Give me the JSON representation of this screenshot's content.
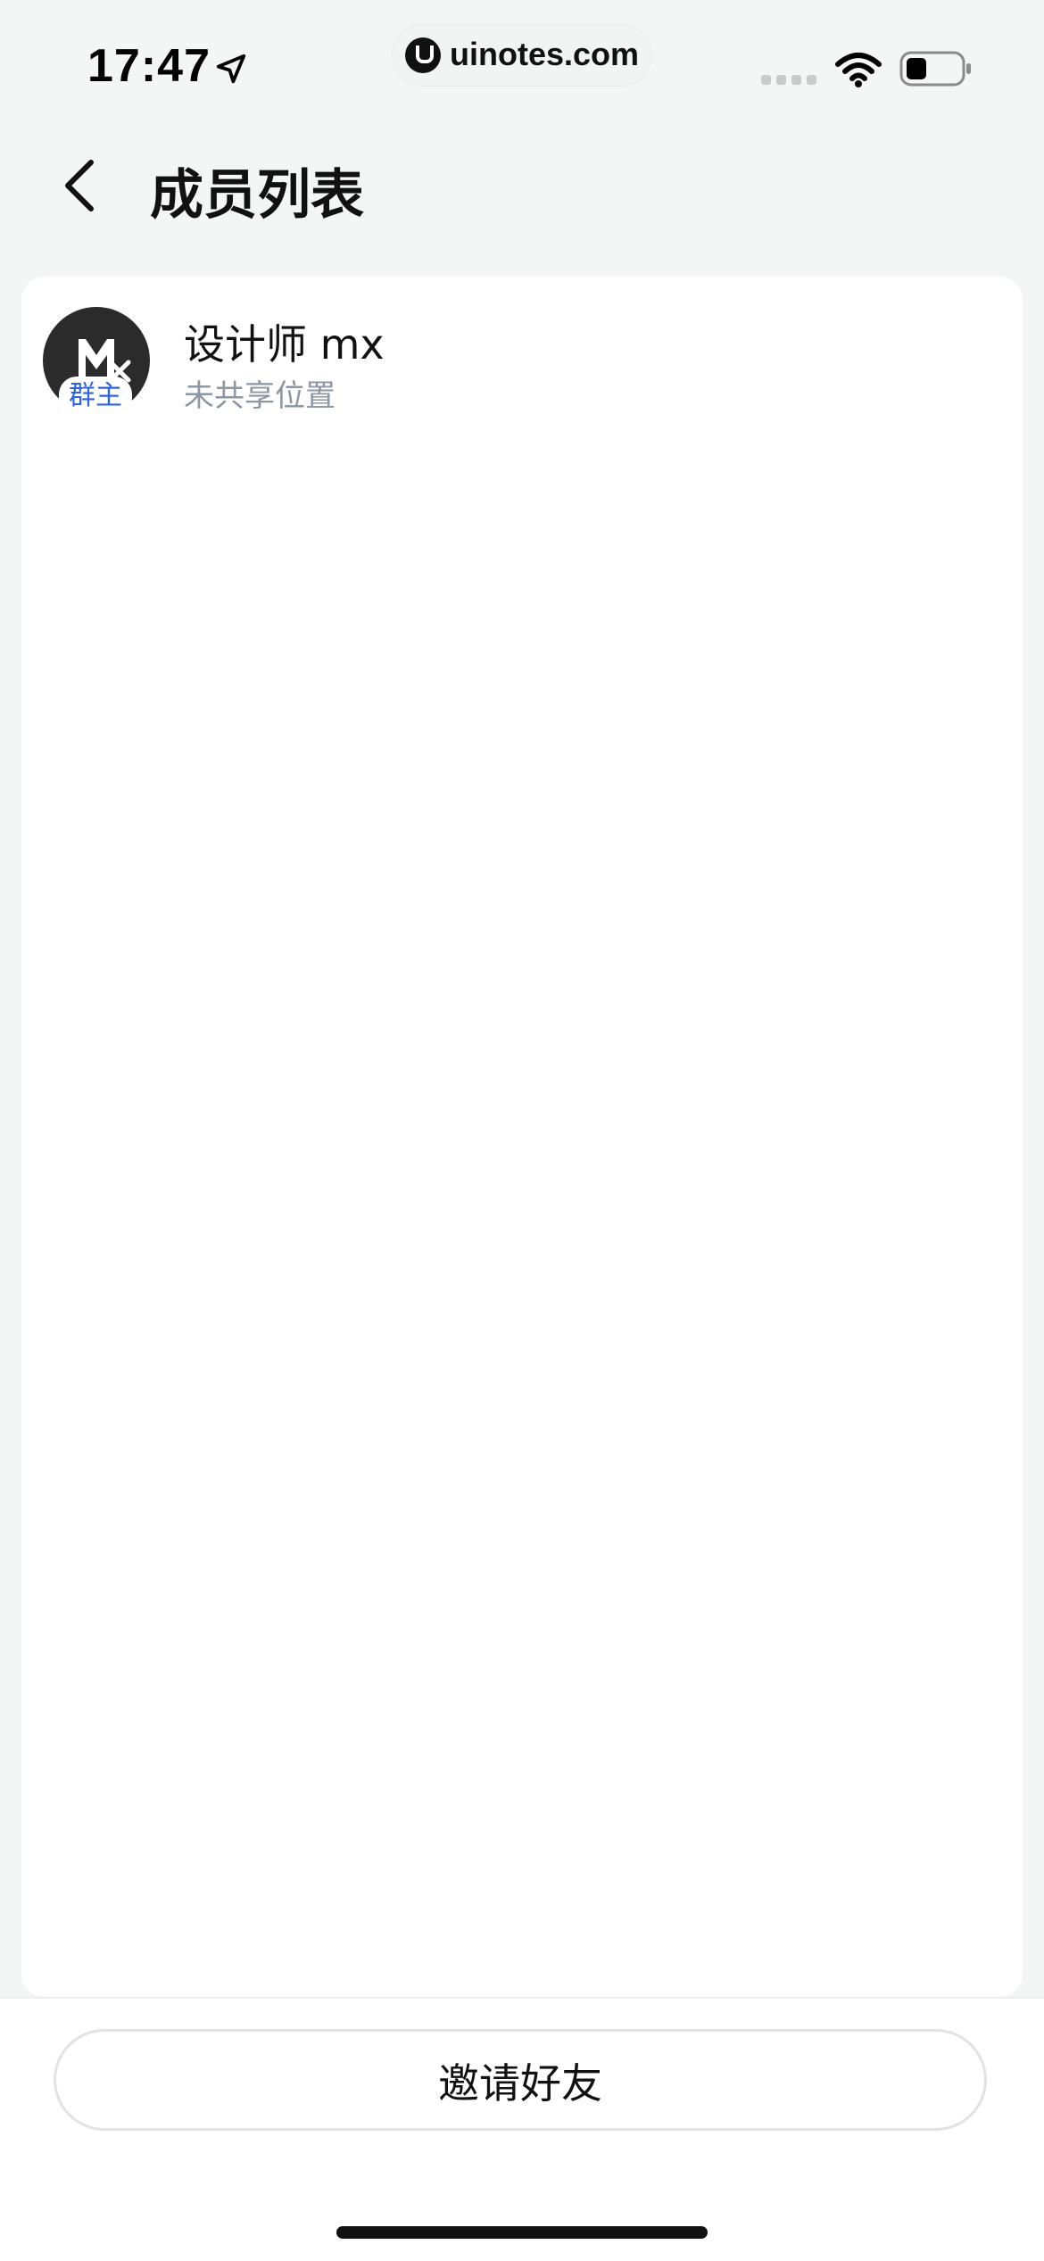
{
  "status_bar": {
    "time": "17:47",
    "url": "uinotes.com",
    "icons": [
      "location-arrow-icon",
      "uinotes-logo-icon",
      "signal-icon",
      "wifi-icon",
      "battery-icon"
    ]
  },
  "header": {
    "title": "成员列表",
    "back_icon": "chevron-left-icon"
  },
  "members": [
    {
      "name": "设计师 mx",
      "status": "未共享位置",
      "badge": "群主",
      "avatar_icon": "mx-logo-avatar"
    }
  ],
  "footer": {
    "invite_label": "邀请好友"
  },
  "colors": {
    "background": "#f4f6f5",
    "card": "#ffffff",
    "badge_text": "#2f63d8",
    "status_text": "#8d96a3",
    "avatar_bg": "#2b2b2b"
  }
}
